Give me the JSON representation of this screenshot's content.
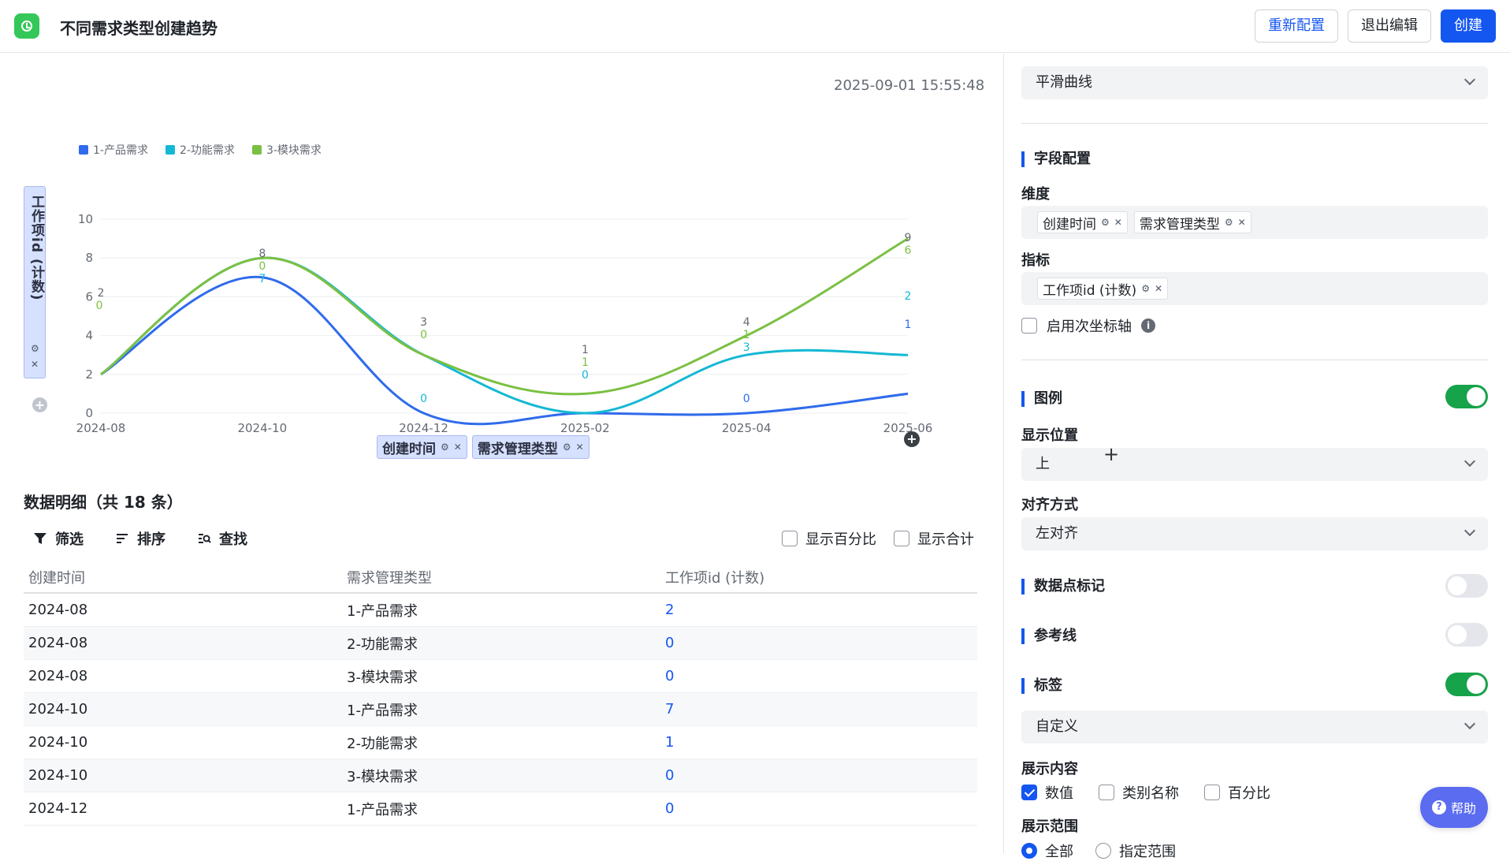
{
  "header": {
    "title": "不同需求类型创建趋势",
    "reset_label": "重新配置",
    "exit_label": "退出编辑",
    "create_label": "创建"
  },
  "chart_panel": {
    "timestamp": "2025-09-01 15:55:48",
    "y_axis_field": "工作项id (计数)",
    "x_fields": [
      "创建时间",
      "需求管理类型"
    ]
  },
  "chart_data": {
    "type": "line",
    "smooth": true,
    "categories": [
      "2024-08",
      "2024-10",
      "2024-12",
      "2025-02",
      "2025-04",
      "2025-06"
    ],
    "ylim": [
      0,
      10
    ],
    "yticks": [
      0,
      2,
      4,
      6,
      8,
      10
    ],
    "legend_position": "top-left",
    "grid": true,
    "series": [
      {
        "name": "1-产品需求",
        "color": "#2f6bec",
        "values": [
          2,
          7,
          0,
          0,
          0,
          1
        ]
      },
      {
        "name": "2-功能需求",
        "color": "#14b8d4",
        "values": [
          2,
          8,
          3,
          0,
          3,
          3
        ]
      },
      {
        "name": "3-模块需求",
        "color": "#7bc043",
        "values": [
          2,
          8,
          3,
          1,
          4,
          9
        ]
      }
    ],
    "data_labels": [
      {
        "cat": 0,
        "values": [
          "2",
          "0"
        ]
      },
      {
        "cat": 1,
        "values": [
          "8",
          "0",
          "7"
        ]
      },
      {
        "cat": 2,
        "values": [
          "3",
          "0",
          "0"
        ]
      },
      {
        "cat": 3,
        "values": [
          "1",
          "1",
          "0"
        ]
      },
      {
        "cat": 4,
        "values": [
          "4",
          "1",
          "3",
          "0"
        ]
      },
      {
        "cat": 5,
        "values": [
          "9",
          "6",
          "2",
          "1"
        ]
      }
    ]
  },
  "detail": {
    "title": "数据明细（共 18 条）",
    "toolbar": {
      "filter": "筛选",
      "sort": "排序",
      "search": "查找",
      "show_percent": "显示百分比",
      "show_total": "显示合计"
    },
    "columns": [
      "创建时间",
      "需求管理类型",
      "工作项id (计数)"
    ],
    "rows": [
      [
        "2024-08",
        "1-产品需求",
        "2"
      ],
      [
        "2024-08",
        "2-功能需求",
        "0"
      ],
      [
        "2024-08",
        "3-模块需求",
        "0"
      ],
      [
        "2024-10",
        "1-产品需求",
        "7"
      ],
      [
        "2024-10",
        "2-功能需求",
        "1"
      ],
      [
        "2024-10",
        "3-模块需求",
        "0"
      ],
      [
        "2024-12",
        "1-产品需求",
        "0"
      ]
    ]
  },
  "settings": {
    "chart_style": "平滑曲线",
    "field_config_title": "字段配置",
    "dimension_label": "维度",
    "dimensions": [
      "创建时间",
      "需求管理类型"
    ],
    "metric_label": "指标",
    "metrics": [
      "工作项id (计数)"
    ],
    "secondary_axis_label": "启用次坐标轴",
    "legend_title": "图例",
    "legend_on": true,
    "position_label": "显示位置",
    "position_value": "上",
    "align_label": "对齐方式",
    "align_value": "左对齐",
    "markers_title": "数据点标记",
    "reference_title": "参考线",
    "labels_title": "标签",
    "labels_on": true,
    "label_mode": "自定义",
    "content_label": "展示内容",
    "content_value": "数值",
    "content_category": "类别名称",
    "content_percent": "百分比",
    "range_label": "展示范围",
    "range_all": "全部",
    "range_custom": "指定范围"
  },
  "help_label": "帮助"
}
